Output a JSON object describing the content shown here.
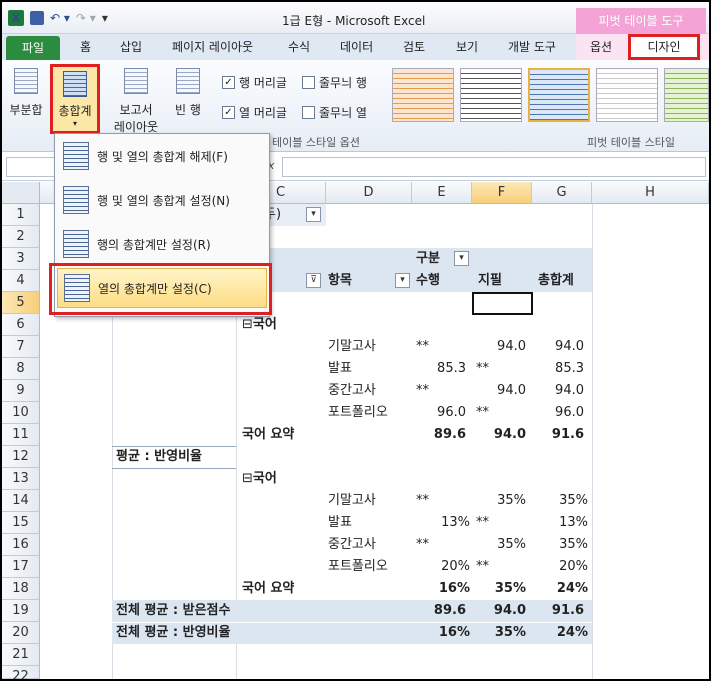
{
  "window": {
    "title": "1급 E형 - Microsoft Excel",
    "context_title": "피벗 테이블 도구"
  },
  "tabs": {
    "file": "파일",
    "items": [
      "홈",
      "삽입",
      "페이지 레이아웃",
      "수식",
      "데이터",
      "검토",
      "보기",
      "개발 도구",
      "옵션"
    ],
    "design": "디자인"
  },
  "ribbon": {
    "subtotal": "부분합",
    "grand_totals": "총합계",
    "report_layout_1": "보고서",
    "report_layout_2": "레이아웃",
    "blank_rows": "빈 행",
    "row_headers": "행 머리글",
    "banded_rows": "줄무늬 행",
    "col_headers": "열 머리글",
    "banded_cols": "줄무늬 열",
    "style_options_label": "테이블 스타일 옵션",
    "styles_label": "피벗 테이블 스타일"
  },
  "menu": {
    "items": [
      "행 및 열의 총합계 해제(F)",
      "행 및 열의 총합계 설정(N)",
      "행의 총합계만 설정(R)",
      "열의 총합계만 설정(C)"
    ]
  },
  "formula_bar": {
    "fx": "fx"
  },
  "sheet": {
    "columns": [
      "C",
      "D",
      "E",
      "F",
      "G",
      "H"
    ],
    "rows": [
      "1",
      "2",
      "3",
      "4",
      "5",
      "6",
      "7",
      "8",
      "9",
      "10",
      "11",
      "12",
      "13",
      "14",
      "15",
      "16",
      "17",
      "18",
      "19",
      "20",
      "21",
      "22"
    ],
    "filter_partial": "두)",
    "header": {
      "gubun": "구분",
      "hangmok": "항목",
      "suhaeng": "수행",
      "jipil": "지필",
      "total": "총합계"
    },
    "group1": {
      "subject": "국어",
      "items": [
        {
          "name": "기말고사",
          "e": "**",
          "f": "94.0",
          "g": "94.0"
        },
        {
          "name": "발표",
          "e": "85.3",
          "e2": "**",
          "f": "",
          "g": "85.3"
        },
        {
          "name": "중간고사",
          "e": "**",
          "f": "94.0",
          "g": "94.0"
        },
        {
          "name": "포트폴리오",
          "e": "96.0",
          "e2": "**",
          "f": "",
          "g": "96.0"
        }
      ],
      "summary": {
        "label": "국어 요약",
        "e": "89.6",
        "f": "94.0",
        "g": "91.6"
      }
    },
    "avg_label": "평균 : 반영비율",
    "group2": {
      "subject": "국어",
      "items": [
        {
          "name": "기말고사",
          "e": "**",
          "f": "35%",
          "g": "35%"
        },
        {
          "name": "발표",
          "e": "13%",
          "e2": "**",
          "f": "",
          "g": "13%"
        },
        {
          "name": "중간고사",
          "e": "**",
          "f": "35%",
          "g": "35%"
        },
        {
          "name": "포트폴리오",
          "e": "20%",
          "e2": "**",
          "f": "",
          "g": "20%"
        }
      ],
      "summary": {
        "label": "국어 요약",
        "e": "16%",
        "f": "35%",
        "g": "24%"
      }
    },
    "total1": {
      "label": "전체 평균 : 받은점수",
      "e": "89.6",
      "f": "94.0",
      "g": "91.6"
    },
    "total2": {
      "label": "전체 평균 : 반영비율",
      "e": "16%",
      "f": "35%",
      "g": "24%"
    }
  }
}
